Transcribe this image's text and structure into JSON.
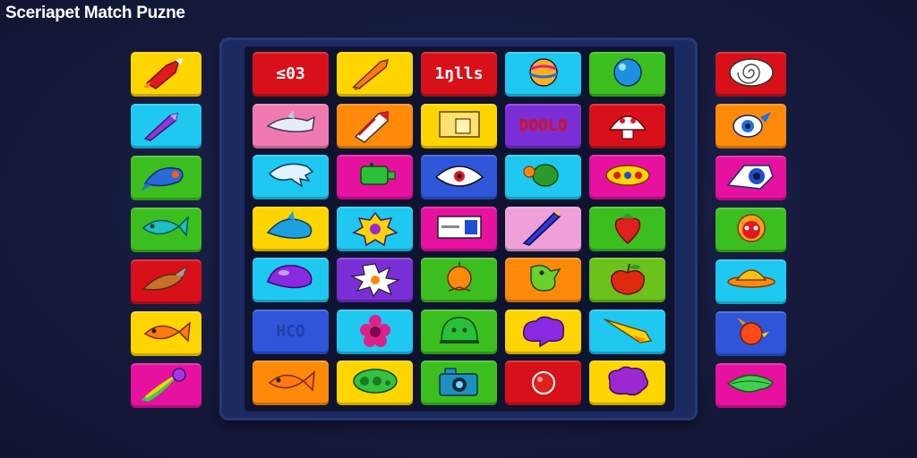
{
  "app": {
    "title": "Sceriapet Match Puzne"
  },
  "colors": {
    "background": "#161b3e",
    "board": "#1b2a60",
    "board_inner": "#0e1430",
    "yellow": "#ffd500",
    "red": "#d8101a",
    "cyan": "#1ec8f0",
    "green": "#3bbf1e",
    "magenta": "#e6119f",
    "orange": "#ff8a0a",
    "purple": "#7a2fd6",
    "pink": "#f07ab0",
    "lightpink": "#f0a0d8",
    "blue": "#2f55d8",
    "lime": "#6ac21a"
  },
  "left_column": [
    {
      "color": "#ffd500",
      "icon": "red-rocket-icon"
    },
    {
      "color": "#1ec8f0",
      "icon": "purple-pen-icon"
    },
    {
      "color": "#3bbf1e",
      "icon": "blue-rocket-fish-icon"
    },
    {
      "color": "#3bbf1e",
      "icon": "teal-fish-icon"
    },
    {
      "color": "#d8101a",
      "icon": "brown-bird-icon"
    },
    {
      "color": "#ffd500",
      "icon": "orange-fish-icon"
    },
    {
      "color": "#e6119f",
      "icon": "rainbow-comet-icon"
    }
  ],
  "right_column": [
    {
      "color": "#d8101a",
      "icon": "swirl-icon"
    },
    {
      "color": "#ff8a0a",
      "icon": "eye-icon"
    },
    {
      "color": "#e6119f",
      "icon": "blue-eye-shell-icon"
    },
    {
      "color": "#3bbf1e",
      "icon": "red-face-icon"
    },
    {
      "color": "#1ec8f0",
      "icon": "orange-ufo-icon"
    },
    {
      "color": "#2f55d8",
      "icon": "red-bird-icon"
    },
    {
      "color": "#e6119f",
      "icon": "green-leaf-icon"
    }
  ],
  "grid": [
    [
      {
        "color": "#d8101a",
        "icon": "text-tile",
        "text": "≤03",
        "text_color": "#ffffff"
      },
      {
        "color": "#ffd500",
        "icon": "brush-icon"
      },
      {
        "color": "#d8101a",
        "icon": "text-tile",
        "text": "1ŋlls",
        "text_color": "#ffffff"
      },
      {
        "color": "#1ec8f0",
        "icon": "striped-ball-icon"
      },
      {
        "color": "#3bbf1e",
        "icon": "blue-orb-icon"
      }
    ],
    [
      {
        "color": "#f07ab0",
        "icon": "shark-icon"
      },
      {
        "color": "#ff8a0a",
        "icon": "crayon-icon"
      },
      {
        "color": "#ffd500",
        "icon": "box-icon"
      },
      {
        "color": "#7a2fd6",
        "icon": "text-tile",
        "text": "DOOLO",
        "text_color": "#d8101a"
      },
      {
        "color": "#d8101a",
        "icon": "mushroom-icon"
      }
    ],
    [
      {
        "color": "#1ec8f0",
        "icon": "ghost-icon"
      },
      {
        "color": "#e6119f",
        "icon": "green-gadget-icon"
      },
      {
        "color": "#2f55d8",
        "icon": "white-eye-icon"
      },
      {
        "color": "#1ec8f0",
        "icon": "green-turtle-icon"
      },
      {
        "color": "#e6119f",
        "icon": "yellow-pod-icon"
      }
    ],
    [
      {
        "color": "#ffd500",
        "icon": "blue-dolphin-icon"
      },
      {
        "color": "#1ec8f0",
        "icon": "splat-flower-icon"
      },
      {
        "color": "#e6119f",
        "icon": "card-icon"
      },
      {
        "color": "#f0a0d8",
        "icon": "pencil-icon"
      },
      {
        "color": "#3bbf1e",
        "icon": "strawberry-icon"
      }
    ],
    [
      {
        "color": "#1ec8f0",
        "icon": "purple-blob-icon"
      },
      {
        "color": "#7a2fd6",
        "icon": "white-splat-icon"
      },
      {
        "color": "#3bbf1e",
        "icon": "orange-ball-icon"
      },
      {
        "color": "#ff8a0a",
        "icon": "green-creature-icon"
      },
      {
        "color": "#6ac21a",
        "icon": "apple-icon"
      }
    ],
    [
      {
        "color": "#2f55d8",
        "icon": "text-tile",
        "text": "HCO",
        "text_color": "#1e3fa8"
      },
      {
        "color": "#1ec8f0",
        "icon": "pink-flower-icon"
      },
      {
        "color": "#3bbf1e",
        "icon": "green-dome-icon"
      },
      {
        "color": "#ffd500",
        "icon": "purple-cloud-icon"
      },
      {
        "color": "#1ec8f0",
        "icon": "yellow-comet-icon"
      }
    ],
    [
      {
        "color": "#ff8a0a",
        "icon": "orange-fish-icon"
      },
      {
        "color": "#ffd500",
        "icon": "green-pod-icon"
      },
      {
        "color": "#3bbf1e",
        "icon": "camera-icon"
      },
      {
        "color": "#d8101a",
        "icon": "red-ball-icon"
      },
      {
        "color": "#ffd500",
        "icon": "purple-splat-icon"
      }
    ]
  ]
}
